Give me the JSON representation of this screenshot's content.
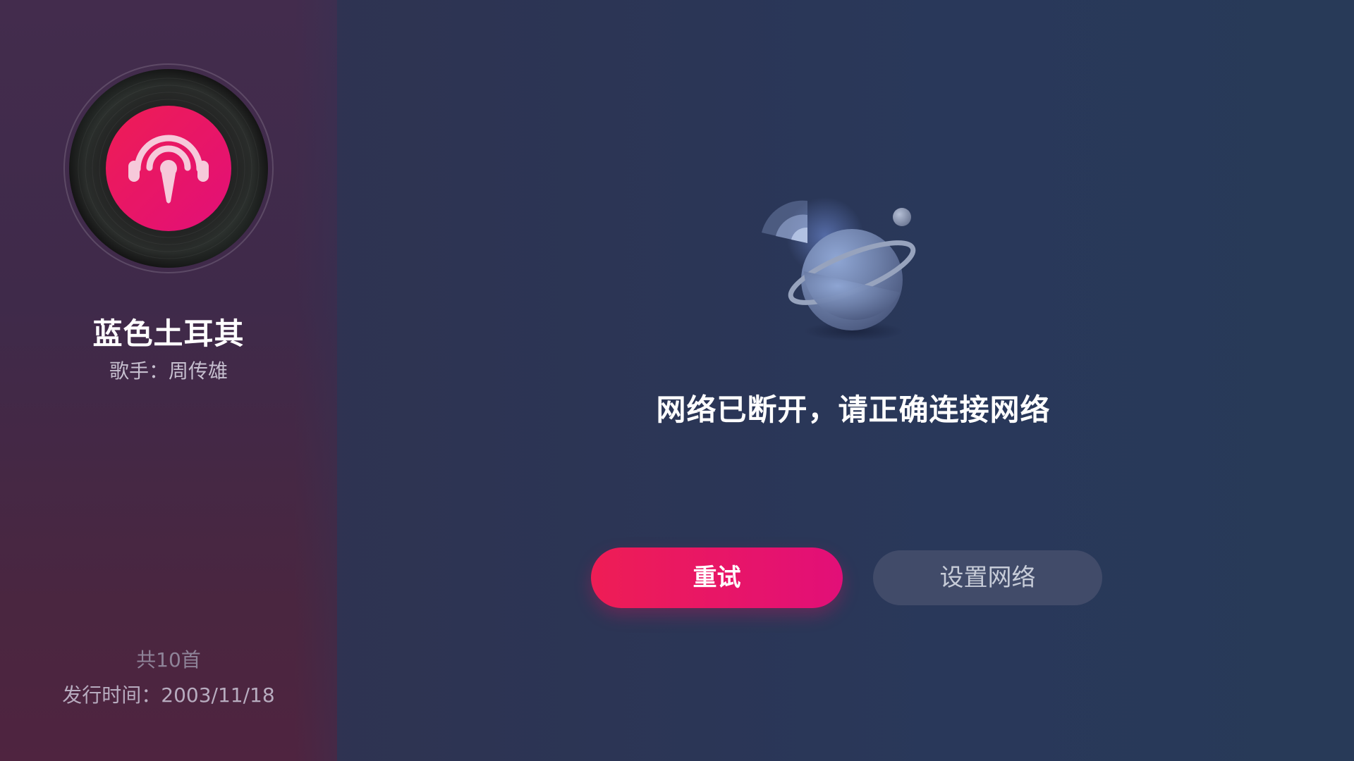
{
  "album": {
    "title": "蓝色土耳其",
    "artist": "歌手：周传雄",
    "track_count": "共10首",
    "release_date": "发行时间：2003/11/18",
    "cover_icon": "podcast-headphone-mic-icon"
  },
  "error": {
    "illustration": "planet-signal-lost-icon",
    "message": "网络已断开，请正确连接网络"
  },
  "actions": {
    "retry_label": "重试",
    "settings_label": "设置网络"
  },
  "colors": {
    "accent": "#ee1d55",
    "accent_end": "#e20f78",
    "secondary_button": "#414b69"
  }
}
